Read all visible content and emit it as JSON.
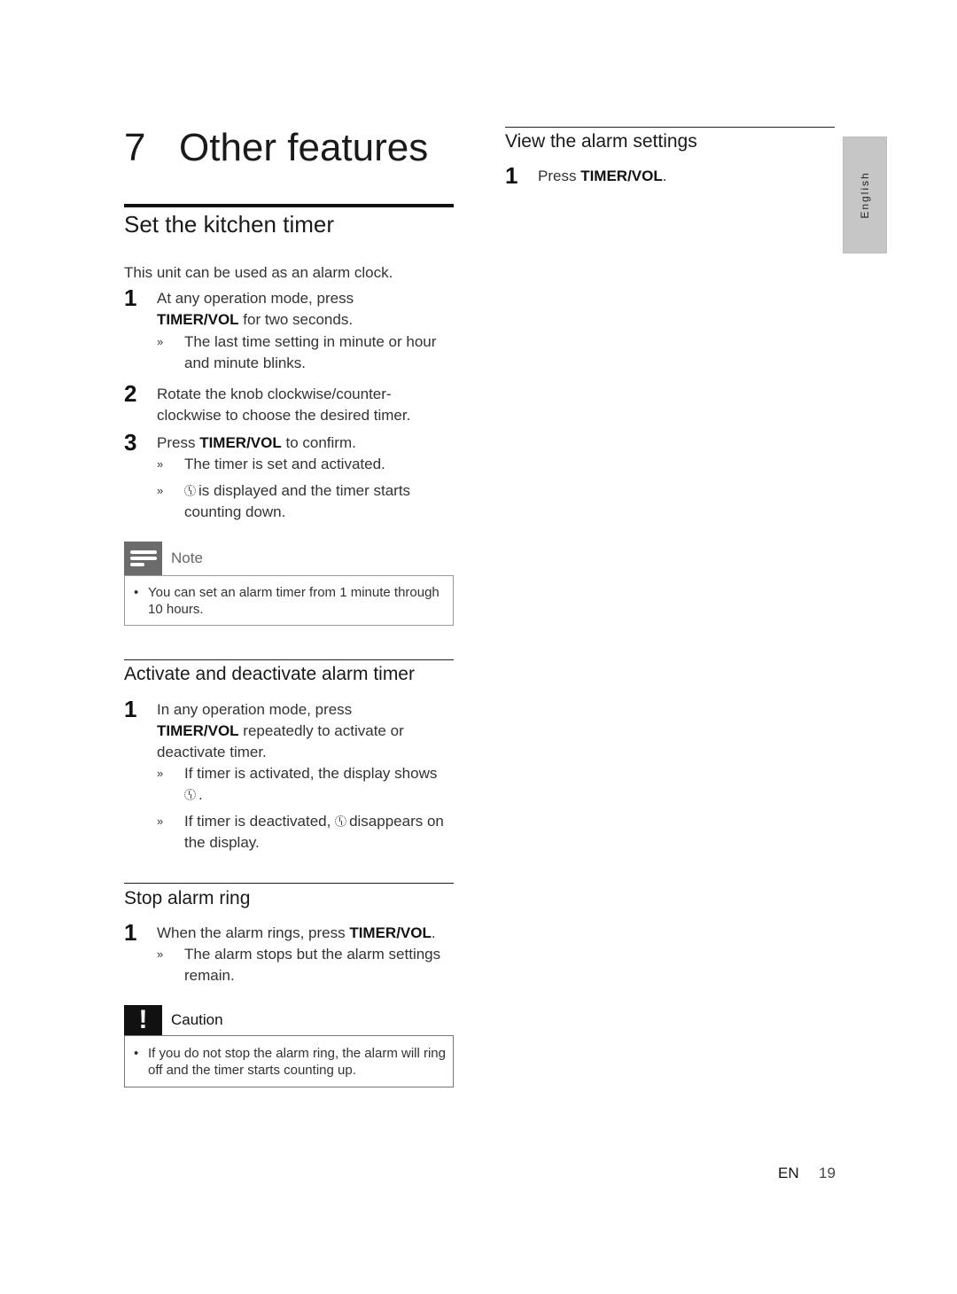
{
  "chapter": {
    "number": "7",
    "title": "Other features"
  },
  "kitchen_timer": {
    "title": "Set the kitchen timer",
    "intro": "This unit can be used as an alarm clock.",
    "steps": [
      {
        "num": "1",
        "text_before": "At any operation mode, press ",
        "key": "TIMER/VOL",
        "text_after": " for two seconds.",
        "results": [
          "The last time setting in minute or hour and minute blinks."
        ]
      },
      {
        "num": "2",
        "text_before": "Rotate the knob clockwise/counter-clockwise to choose the desired timer.",
        "key": "",
        "text_after": "",
        "results": []
      },
      {
        "num": "3",
        "text_before": "Press ",
        "key": "TIMER/VOL",
        "text_after": " to confirm.",
        "results": [
          "The timer is set and activated.",
          "is displayed and the timer starts counting down."
        ]
      }
    ],
    "note": {
      "label": "Note",
      "icon": "note-lines-icon",
      "items": [
        "You can set an alarm timer from 1 minute through 10 hours."
      ]
    }
  },
  "activate_timer": {
    "title": "Activate and deactivate alarm timer",
    "steps": [
      {
        "num": "1",
        "text_before": "In any operation mode, press ",
        "key": "TIMER/VOL",
        "text_after": " repeatedly to activate or deactivate timer.",
        "results": [
          "If timer is activated, the display shows",
          "If timer is deactivated,",
          "disappears on the display."
        ]
      }
    ]
  },
  "stop_alarm": {
    "title": "Stop alarm ring",
    "steps": [
      {
        "num": "1",
        "text_before": "When the alarm rings, press ",
        "key": "TIMER/VOL",
        "text_after": ".",
        "results": [
          "The alarm stops but the alarm settings remain."
        ]
      }
    ],
    "caution": {
      "label": "Caution",
      "icon": "exclamation-icon",
      "items": [
        "If you do not stop the alarm ring, the alarm will ring off and the timer starts counting up."
      ]
    }
  },
  "view_alarm": {
    "title": "View the alarm settings",
    "steps": [
      {
        "num": "1",
        "text_before": "Press ",
        "key": "TIMER/VOL",
        "text_after": "."
      }
    ]
  },
  "language_tab": "English",
  "footer": {
    "lang": "EN",
    "page": "19"
  }
}
